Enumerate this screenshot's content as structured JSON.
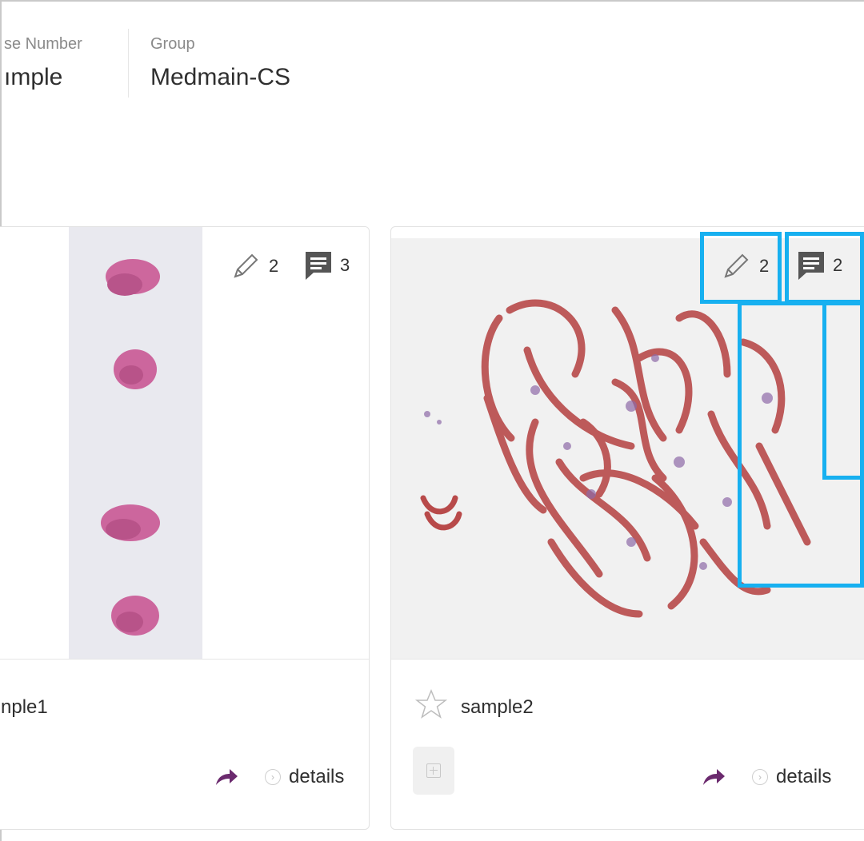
{
  "header": {
    "case_number_label": "se Number",
    "case_number_value": "ımple",
    "group_label": "Group",
    "group_value": "Medmain-CS"
  },
  "cards": [
    {
      "name": "nple1",
      "annotations_count": "2",
      "comments_count": "3",
      "details_label": "details",
      "icons": [
        "pencil-icon",
        "comment-icon",
        "share-icon",
        "chevron-right-icon"
      ]
    },
    {
      "name": "sample2",
      "annotations_count": "2",
      "comments_count": "2",
      "details_label": "details",
      "icons": [
        "star-icon",
        "pencil-icon",
        "comment-icon",
        "add-icon",
        "share-icon",
        "chevron-right-icon"
      ]
    }
  ],
  "colors": {
    "highlight": "#17b0f0",
    "share_icon": "#6b2a6e",
    "tissue_pink": "#c8508f",
    "tissue_red": "#b84a4a"
  }
}
